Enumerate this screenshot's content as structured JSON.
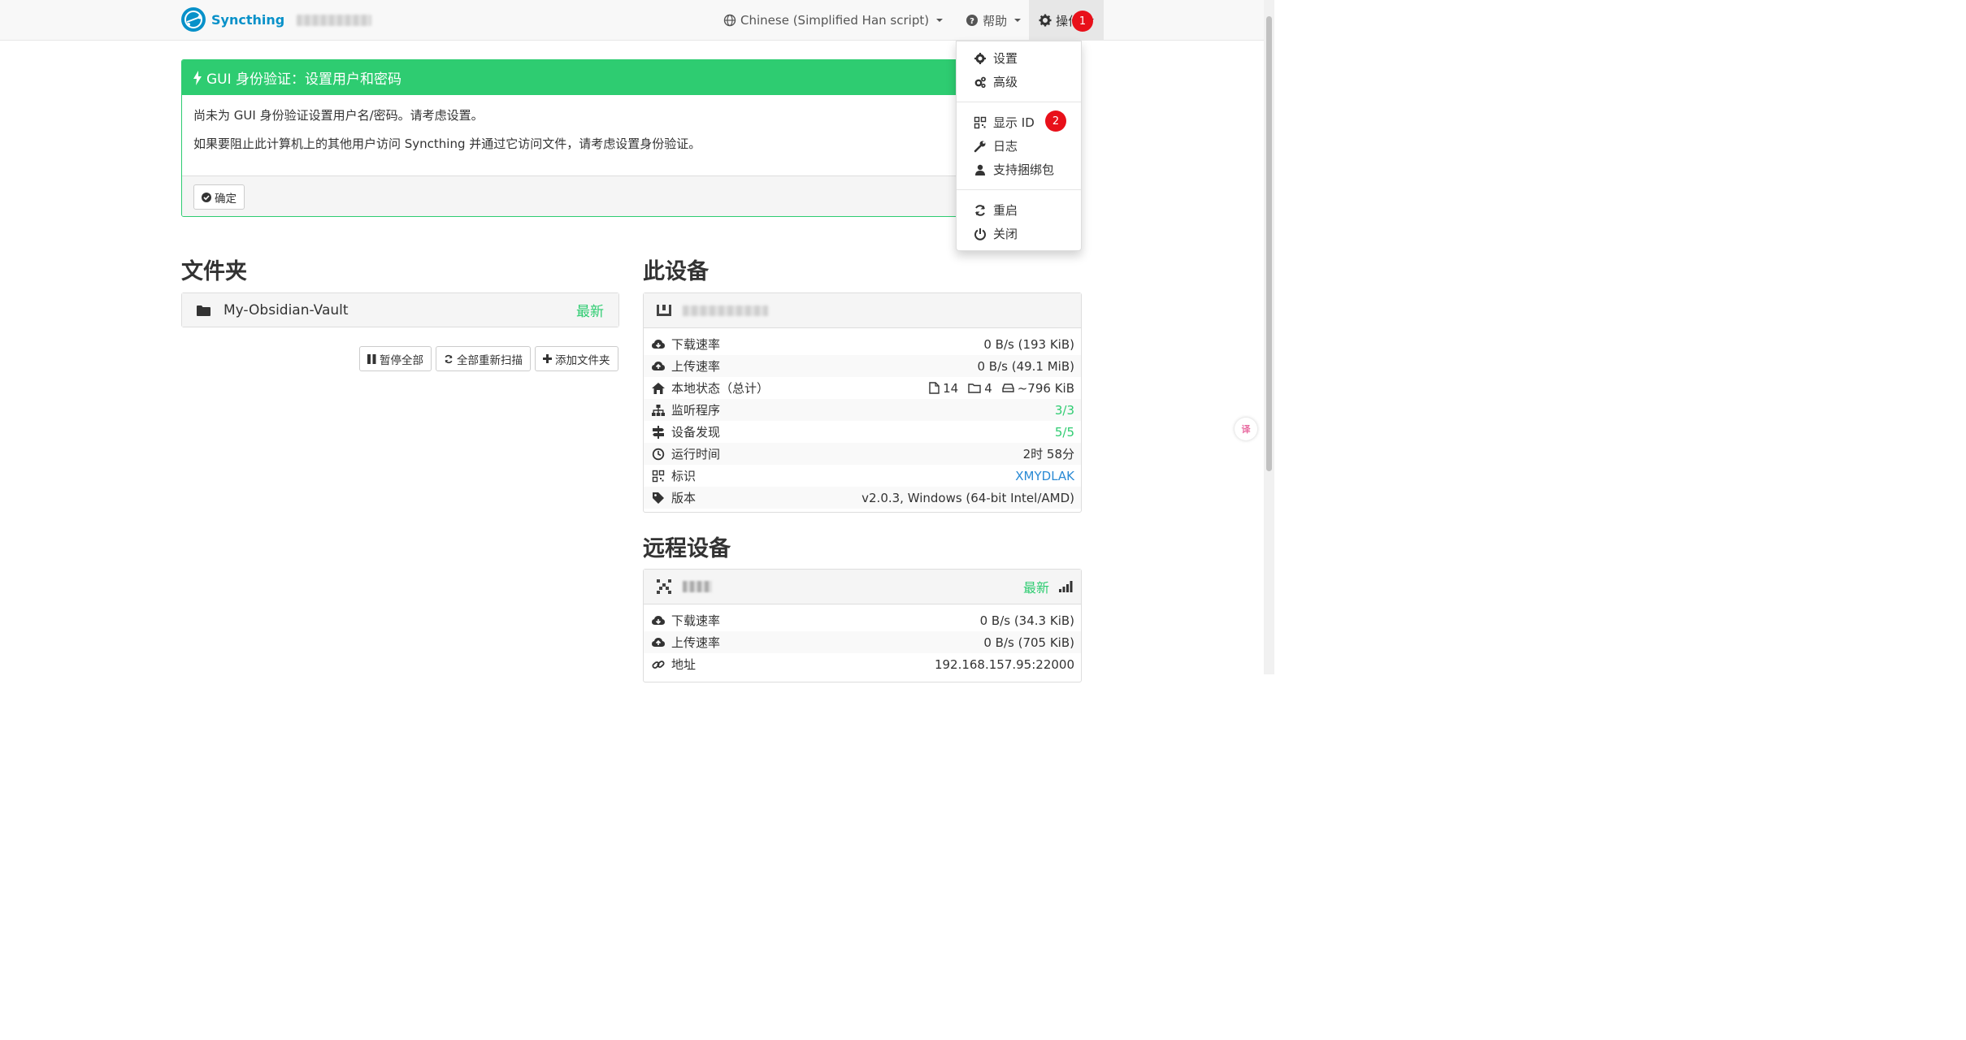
{
  "navbar": {
    "brand": "Syncthing",
    "language": "Chinese (Simplified Han script)",
    "help": "帮助",
    "actions": "操作",
    "actions_badge": "1"
  },
  "actions_menu": {
    "items": [
      "设置",
      "高级",
      "显示 ID",
      "日志",
      "支持捆绑包",
      "重启",
      "关闭"
    ],
    "show_id_badge": "2"
  },
  "alert": {
    "title": "GUI 身份验证：设置用户和密码",
    "line1": "尚未为 GUI 身份验证设置用户名/密码。请考虑设置。",
    "line2": "如果要阻止此计算机上的其他用户访问 Syncthing 并通过它访问文件，请考虑设置身份验证。",
    "ok": "确定"
  },
  "folders": {
    "heading": "文件夹",
    "items": [
      {
        "name": "My-Obsidian-Vault",
        "status": "最新"
      }
    ],
    "pause_all": "暂停全部",
    "rescan_all": "全部重新扫描",
    "add_folder": "添加文件夹"
  },
  "this_device": {
    "heading": "此设备",
    "rows": {
      "download_label": "下载速率",
      "download_value": "0 B/s (193 KiB)",
      "upload_label": "上传速率",
      "upload_value": "0 B/s (49.1 MiB)",
      "local_label": "本地状态（总计）",
      "local_files": "14",
      "local_dirs": "4",
      "local_size": "~796 KiB",
      "listeners_label": "监听程序",
      "listeners_value": "3/3",
      "discovery_label": "设备发现",
      "discovery_value": "5/5",
      "uptime_label": "运行时间",
      "uptime_value": "2时 58分",
      "id_label": "标识",
      "id_value": "XMYDLAK",
      "version_label": "版本",
      "version_value": "v2.0.3, Windows (64-bit Intel/AMD)"
    }
  },
  "remote_devices": {
    "heading": "远程设备",
    "device_status": "最新",
    "rows": {
      "download_label": "下载速率",
      "download_value": "0 B/s (34.3 KiB)",
      "upload_label": "上传速率",
      "upload_value": "0 B/s (705 KiB)",
      "address_label": "地址",
      "address_value": "192.168.157.95:22000"
    }
  },
  "colors": {
    "brand": "#0891c9",
    "success": "#2ecc71",
    "badge": "#e8101a",
    "link": "#2a8ad4"
  }
}
